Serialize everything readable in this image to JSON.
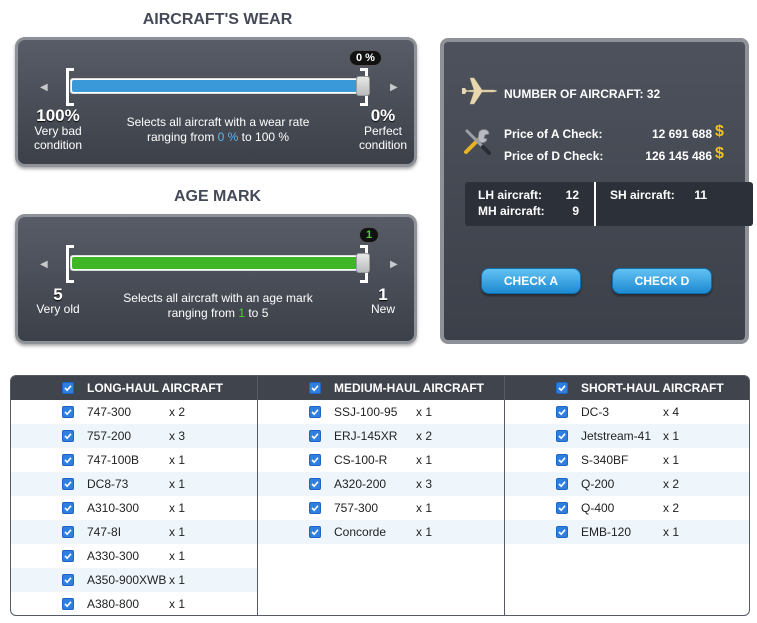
{
  "wear": {
    "title": "AIRCRAFT'S WEAR",
    "bubble": "0 %",
    "left_value": "100%",
    "left_label": "Very bad condition",
    "right_value": "0%",
    "right_label": "Perfect condition",
    "desc_line1": "Selects all aircraft with a wear rate",
    "desc_prefix": "ranging from ",
    "desc_highlight": "0 %",
    "desc_suffix": " to 100 %",
    "fill_fraction": 1.0,
    "fill_color": "#3a9ad9",
    "highlight_color": "#5ab8f0"
  },
  "age": {
    "title": "AGE MARK",
    "bubble": "1",
    "left_value": "5",
    "left_label": "Very old",
    "right_value": "1",
    "right_label": "New",
    "desc_line1": "Selects all aircraft with an age mark",
    "desc_prefix": "ranging from ",
    "desc_highlight": "1",
    "desc_suffix": " to 5",
    "fill_fraction": 1.0,
    "fill_color": "#3fb623",
    "highlight_color": "#4fd030"
  },
  "info": {
    "number_label": "NUMBER OF AIRCRAFT: 32",
    "a_check_label": "Price of A Check:",
    "a_check_value": "12 691 688",
    "d_check_label": "Price of D Check:",
    "d_check_value": "126 145 486",
    "currency": "$",
    "lh_label": "LH aircraft:",
    "lh_value": "12",
    "mh_label": "MH aircraft:",
    "mh_value": "9",
    "sh_label": "SH aircraft:",
    "sh_value": "11",
    "check_a": "CHECK A",
    "check_d": "CHECK D"
  },
  "lists": {
    "long": {
      "title": "LONG-HAUL AIRCRAFT",
      "items": [
        {
          "name": "747-300",
          "qty": "x 2"
        },
        {
          "name": "757-200",
          "qty": "x 3"
        },
        {
          "name": "747-100B",
          "qty": "x 1"
        },
        {
          "name": "DC8-73",
          "qty": "x 1"
        },
        {
          "name": "A310-300",
          "qty": "x 1"
        },
        {
          "name": "747-8I",
          "qty": "x 1"
        },
        {
          "name": "A330-300",
          "qty": "x 1"
        },
        {
          "name": "A350-900XWB",
          "qty": "x 1"
        },
        {
          "name": "A380-800",
          "qty": "x 1"
        }
      ]
    },
    "medium": {
      "title": "MEDIUM-HAUL AIRCRAFT",
      "items": [
        {
          "name": "SSJ-100-95",
          "qty": "x 1"
        },
        {
          "name": "ERJ-145XR",
          "qty": "x 2"
        },
        {
          "name": "CS-100-R",
          "qty": "x 1"
        },
        {
          "name": "A320-200",
          "qty": "x 3"
        },
        {
          "name": "757-300",
          "qty": "x 1"
        },
        {
          "name": "Concorde",
          "qty": "x 1"
        }
      ]
    },
    "short": {
      "title": "SHORT-HAUL AIRCRAFT",
      "items": [
        {
          "name": "DC-3",
          "qty": "x 4"
        },
        {
          "name": "Jetstream-41",
          "qty": "x 1"
        },
        {
          "name": "S-340BF",
          "qty": "x 1"
        },
        {
          "name": "Q-200",
          "qty": "x 2"
        },
        {
          "name": "Q-400",
          "qty": "x 2"
        },
        {
          "name": "EMB-120",
          "qty": "x 1"
        }
      ]
    }
  }
}
